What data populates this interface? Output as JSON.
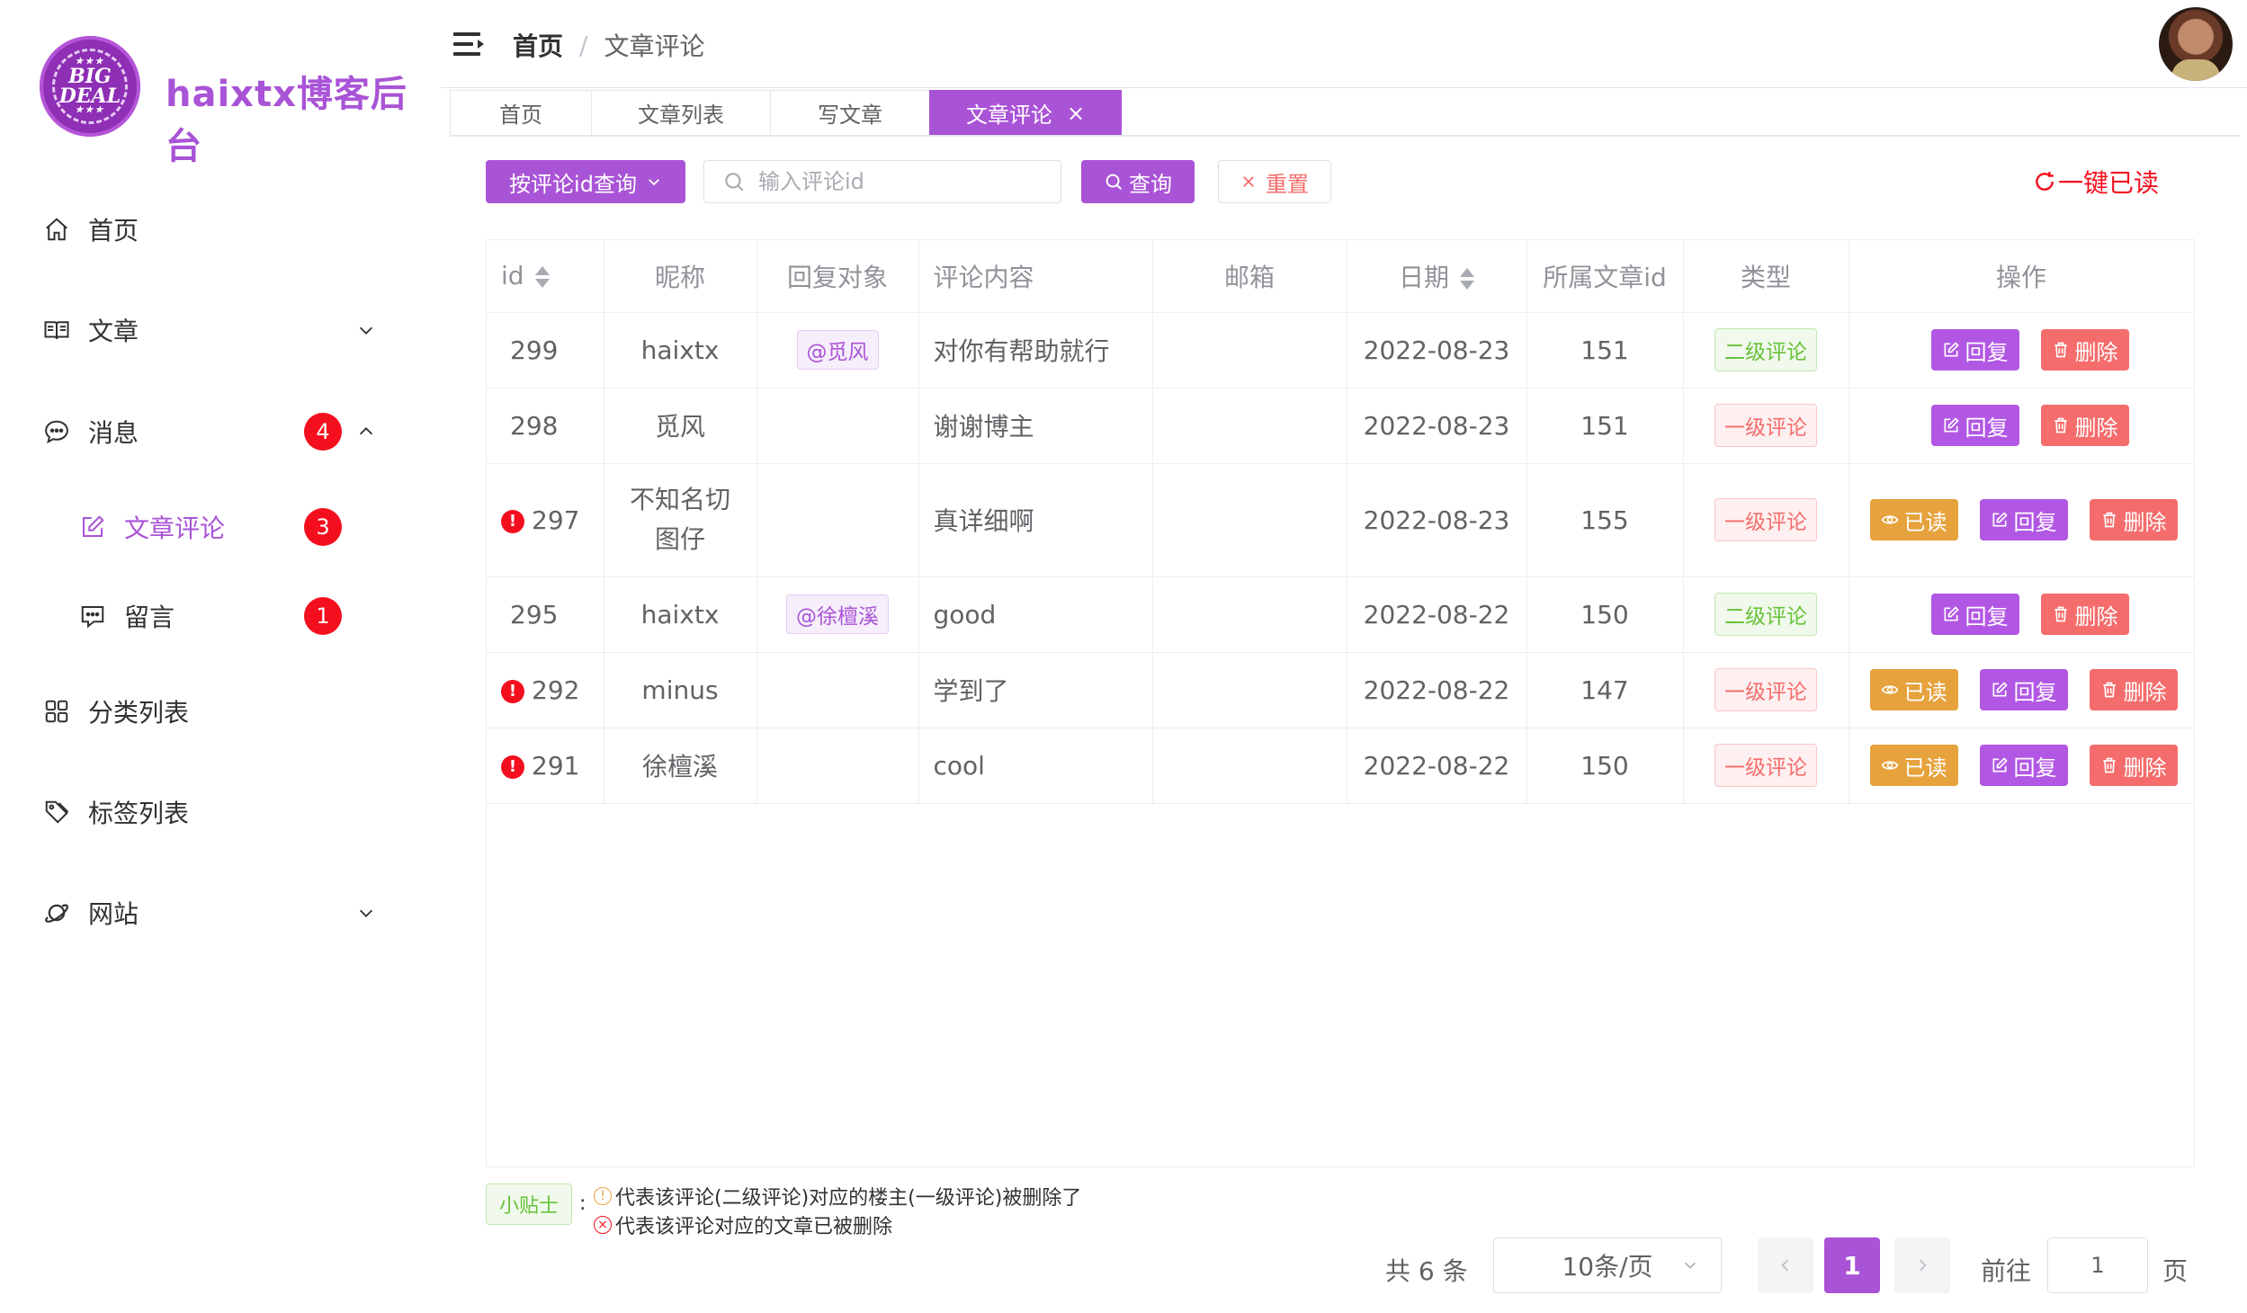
{
  "brand": {
    "logo_text_top": "BIG",
    "logo_text_bottom": "DEAL",
    "logo_stars": "★★★",
    "title": "haixtx博客后台"
  },
  "sidebar": {
    "items": [
      {
        "label": "首页",
        "icon": "home-icon"
      },
      {
        "label": "文章",
        "icon": "book-icon",
        "arrow": "down"
      },
      {
        "label": "消息",
        "icon": "chat-icon",
        "badge": "4",
        "arrow": "up"
      },
      {
        "label": "文章评论",
        "icon": "edit-icon",
        "badge": "3",
        "active": true
      },
      {
        "label": "留言",
        "icon": "message-icon",
        "badge": "1"
      },
      {
        "label": "分类列表",
        "icon": "grid-icon"
      },
      {
        "label": "标签列表",
        "icon": "tag-icon"
      },
      {
        "label": "网站",
        "icon": "planet-icon",
        "arrow": "down"
      }
    ]
  },
  "header": {
    "breadcrumb_home": "首页",
    "breadcrumb_sep": "/",
    "breadcrumb_current": "文章评论"
  },
  "tabs": [
    {
      "label": "首页"
    },
    {
      "label": "文章列表"
    },
    {
      "label": "写文章"
    },
    {
      "label": "文章评论",
      "active": true,
      "close": "×"
    }
  ],
  "toolbar": {
    "select_label": "按评论id查询",
    "search_placeholder": "输入评论id",
    "query_label": "查询",
    "reset_label": "重置",
    "mark_all_label": "一键已读"
  },
  "table": {
    "headers": [
      "id",
      "昵称",
      "回复对象",
      "评论内容",
      "邮箱",
      "日期",
      "所属文章id",
      "类型",
      "操作"
    ],
    "rows": [
      {
        "id": "299",
        "nickname": "haixtx",
        "reply_to": "@觅风",
        "content": "对你有帮助就行",
        "email": "",
        "date": "2022-08-23",
        "article_id": "151",
        "type": "二级评论",
        "level": 2,
        "unread": false
      },
      {
        "id": "298",
        "nickname": "觅风",
        "reply_to": "",
        "content": "谢谢博主",
        "email": "",
        "date": "2022-08-23",
        "article_id": "151",
        "type": "一级评论",
        "level": 1,
        "unread": false
      },
      {
        "id": "297",
        "nickname": "不知名切图仔",
        "reply_to": "",
        "content": "真详细啊",
        "email": "",
        "date": "2022-08-23",
        "article_id": "155",
        "type": "一级评论",
        "level": 1,
        "unread": true
      },
      {
        "id": "295",
        "nickname": "haixtx",
        "reply_to": "@徐檀溪",
        "content": "good",
        "email": "",
        "date": "2022-08-22",
        "article_id": "150",
        "type": "二级评论",
        "level": 2,
        "unread": false
      },
      {
        "id": "292",
        "nickname": "minus",
        "reply_to": "",
        "content": "学到了",
        "email": "",
        "date": "2022-08-22",
        "article_id": "147",
        "type": "一级评论",
        "level": 1,
        "unread": true
      },
      {
        "id": "291",
        "nickname": "徐檀溪",
        "reply_to": "",
        "content": "cool",
        "email": "",
        "date": "2022-08-22",
        "article_id": "150",
        "type": "一级评论",
        "level": 1,
        "unread": true
      }
    ],
    "unread_mark": "!",
    "actions": {
      "read": "已读",
      "reply": "回复",
      "delete": "删除"
    }
  },
  "tips": {
    "tag": "小贴士",
    "colon": ":",
    "line1": "代表该评论(二级评论)对应的楼主(一级评论)被删除了",
    "line2": "代表该评论对应的文章已被删除",
    "line1_icon": "!",
    "line2_icon": "×"
  },
  "pagination": {
    "total": "共 6 条",
    "page_size": "10条/页",
    "current_page": "1",
    "goto_label": "前往",
    "goto_value": "1",
    "page_suffix": "页"
  },
  "colors": {
    "accent": "#a953d6",
    "danger": "#f56c6c",
    "warning": "#e6a23c",
    "badge": "#f40f1e"
  }
}
